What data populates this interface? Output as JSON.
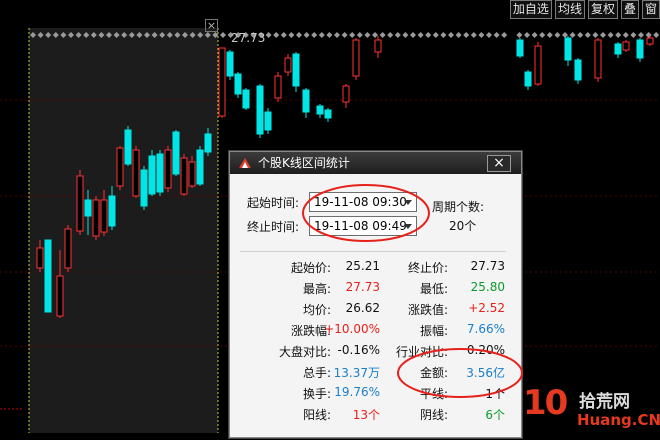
{
  "toolbar": {
    "buttons": [
      "加自选",
      "均线",
      "复权",
      "叠",
      "窗"
    ]
  },
  "chart": {
    "price_label": "27.73",
    "colors": {
      "up": "#ff3232",
      "down": "#00e6e6",
      "bg": "#000000",
      "selection": "#1e1e1e"
    }
  },
  "dialog": {
    "title": "个股K线区间统计",
    "close_icon": "close-icon",
    "start_time_label": "起始时间:",
    "start_time_value": "19-11-08 09:30",
    "end_time_label": "终止时间:",
    "end_time_value": "19-11-08 09:49",
    "period_count_label": "周期个数:",
    "period_count_value": "20个",
    "stats": [
      {
        "label": "起始价:",
        "value": "25.21",
        "color": "#111111"
      },
      {
        "label": "终止价:",
        "value": "27.73",
        "color": "#111111"
      },
      {
        "label": "最高:",
        "value": "27.73",
        "color": "#e8201a"
      },
      {
        "label": "最低:",
        "value": "25.80",
        "color": "#0a9a2a"
      },
      {
        "label": "均价:",
        "value": "26.62",
        "color": "#111111"
      },
      {
        "label": "涨跌值:",
        "value": "+2.52",
        "color": "#e8201a"
      },
      {
        "label": "涨跌幅:",
        "value": "+10.00%",
        "color": "#e8201a"
      },
      {
        "label": "振幅:",
        "value": "7.66%",
        "color": "#1a7fc8"
      },
      {
        "label": "大盘对比:",
        "value": "-0.16%",
        "color": "#111111"
      },
      {
        "label": "行业对比:",
        "value": "0.20%",
        "color": "#111111"
      },
      {
        "label": "总手:",
        "value": "13.37万",
        "color": "#1a7fc8"
      },
      {
        "label": "金额:",
        "value": "3.56亿",
        "color": "#1a7fc8"
      },
      {
        "label": "换手:",
        "value": "19.76%",
        "color": "#1a7fc8"
      },
      {
        "label": "平线:",
        "value": "1个",
        "color": "#111111"
      },
      {
        "label": "阳线:",
        "value": "13个",
        "color": "#e8201a"
      },
      {
        "label": "阴线:",
        "value": "6个",
        "color": "#0a9a2a"
      }
    ]
  },
  "watermark": {
    "number": "10",
    "cn": "拾荒网",
    "en": "Huang.CN"
  }
}
